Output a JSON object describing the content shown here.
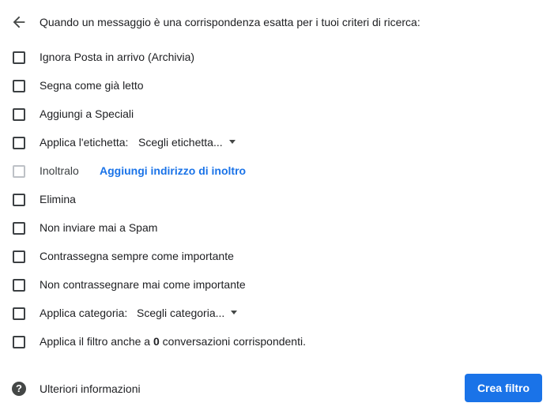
{
  "header": {
    "back_icon": "arrow-back-icon",
    "text": "Quando un messaggio è una corrispondenza esatta per i tuoi criteri di ricerca:"
  },
  "options": {
    "skip_inbox": "Ignora Posta in arrivo (Archivia)",
    "mark_read": "Segna come già letto",
    "star": "Aggiungi a Speciali",
    "apply_label": "Applica l'etichetta:",
    "label_select": "Scegli etichetta...",
    "forward": "Inoltralo",
    "forward_link": "Aggiungi indirizzo di inoltro",
    "delete": "Elimina",
    "never_spam": "Non inviare mai a Spam",
    "always_important": "Contrassegna sempre come importante",
    "never_important": "Non contrassegnare mai come importante",
    "apply_category": "Applica categoria:",
    "category_select": "Scegli categoria...",
    "apply_existing_prefix": "Applica il filtro anche a",
    "apply_existing_count": "0",
    "apply_existing_suffix": "conversazioni corrispondenti."
  },
  "footer": {
    "help_icon": "help-icon",
    "help_glyph": "?",
    "help_text": "Ulteriori informazioni",
    "create_button": "Crea filtro"
  },
  "colors": {
    "accent": "#1a73e8",
    "text": "#202124",
    "checkbox_border": "#3c4043",
    "checkbox_disabled": "#bdc1c6"
  }
}
